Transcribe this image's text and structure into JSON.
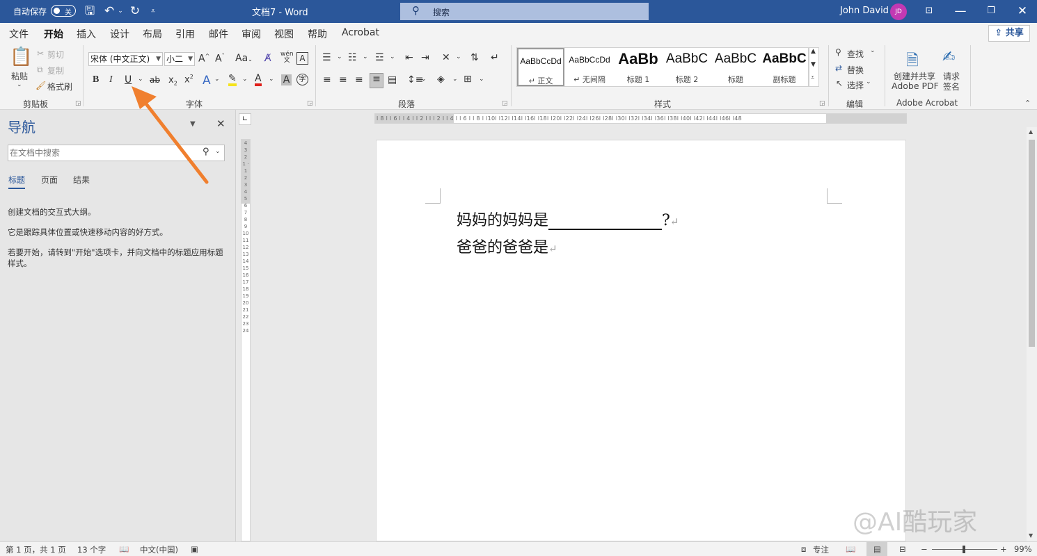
{
  "colors": {
    "brand": "#2b579a",
    "accent_arrow": "#f07f2e",
    "avatar": "#c239b3"
  },
  "titlebar": {
    "autosave_label": "自动保存",
    "autosave_state": "关",
    "doc_title": "文档7  -  Word",
    "search_label": "搜索",
    "user_name": "John David",
    "avatar_initials": "JD"
  },
  "menu": {
    "tabs": [
      "文件",
      "开始",
      "插入",
      "设计",
      "布局",
      "引用",
      "邮件",
      "审阅",
      "视图",
      "帮助",
      "Acrobat"
    ],
    "active": "开始",
    "share": "共享"
  },
  "ribbon": {
    "clipboard": {
      "paste": "粘贴",
      "cut": "剪切",
      "copy": "复制",
      "format_painter": "格式刷",
      "label": "剪贴板"
    },
    "font": {
      "family": "宋体 (中文正文)",
      "size": "小二",
      "label": "字体",
      "grow": "A^",
      "shrink": "A˅",
      "case": "Aa",
      "clear": "A",
      "phonetic": "wén",
      "border": "A",
      "bold": "B",
      "italic": "I",
      "underline": "U",
      "strike": "ab",
      "subscript": "x₂",
      "superscript": "x²",
      "effects": "A",
      "highlight": "ab",
      "font_color": "A",
      "shading": "A",
      "enclose": "字"
    },
    "paragraph": {
      "label": "段落"
    },
    "styles": {
      "label": "样式",
      "items": [
        {
          "sample": "AaBbCcDd",
          "name": "↵ 正文"
        },
        {
          "sample": "AaBbCcDd",
          "name": "↵ 无间隔"
        },
        {
          "sample": "AaBb",
          "name": "标题 1"
        },
        {
          "sample": "AaBbC",
          "name": "标题 2"
        },
        {
          "sample": "AaBbC",
          "name": "标题"
        },
        {
          "sample": "AaBbC",
          "name": "副标题"
        }
      ]
    },
    "editing": {
      "find": "查找",
      "replace": "替换",
      "select": "选择",
      "label": "编辑"
    },
    "acrobat": {
      "create_share_line1": "创建并共享",
      "create_share_line2": "Adobe PDF",
      "request_sign_line1": "请求",
      "request_sign_line2": "签名",
      "label": "Adobe Acrobat"
    }
  },
  "nav": {
    "title": "导航",
    "search_placeholder": "在文档中搜索",
    "tabs": [
      "标题",
      "页面",
      "结果"
    ],
    "active_tab": "标题",
    "help_line1": "创建文档的交互式大纲。",
    "help_line2": "它是跟踪具体位置或快速移动内容的好方式。",
    "help_line3": "若要开始，请转到\"开始\"选项卡，并向文档中的标题应用标题样式。"
  },
  "document": {
    "line1_prefix": "妈妈的妈妈是",
    "line1_suffix": "?",
    "line2": "爸爸的爸爸是",
    "pilcrow": "↵"
  },
  "ruler": {
    "horizontal": "l 8 l  l 6 l  l 4 l  l 2 l    l    l 2 l  l 4 l  l 6 l  l 8 l  l10l  l12l  l14l  l16l  l18l  l20l  l22l  l24l  l26l  l28l  l30l  l32l  l34l  l36l  l38l  l40l  l42l  l44l  l46l  l48",
    "vertical": "4 3 2 1 · 1 2 3 4 5 6 7 8 9 10 11 12 13 14 15 16 17 18 19 20 21 22 23 24"
  },
  "status": {
    "page": "第 1 页，共 1 页",
    "words": "13 个字",
    "language": "中文(中国)",
    "focus": "专注",
    "zoom_minus": "−",
    "zoom_plus": "+",
    "zoom": "99%",
    "zoom_level": 0.99
  },
  "watermark": "@AI酷玩家"
}
